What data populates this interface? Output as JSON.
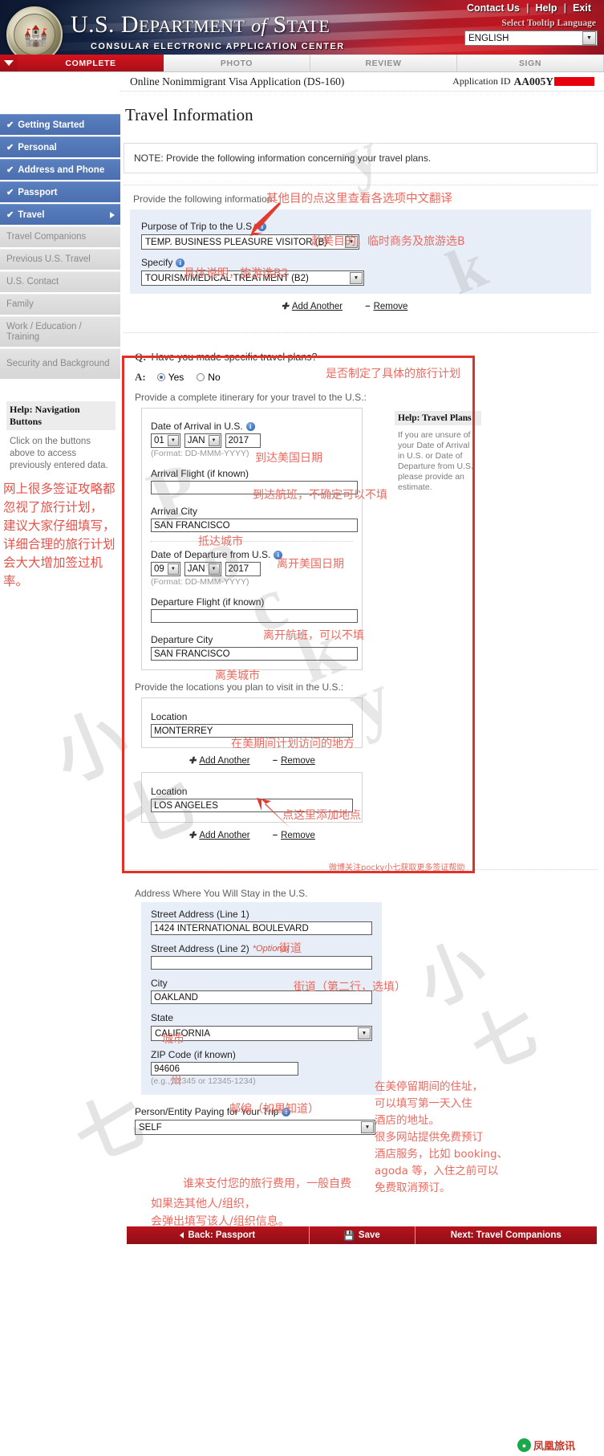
{
  "header": {
    "title_us": "U.S.",
    "title_dept": "D",
    "title_dept_rest": "EPARTMENT",
    "title_of": "of",
    "title_state_s": "S",
    "title_state_rest": "TATE",
    "subtitle": "CONSULAR ELECTRONIC APPLICATION CENTER",
    "links": [
      "Contact Us",
      "Help",
      "Exit"
    ],
    "tooltip_label": "Select Tooltip Language",
    "language_value": "ENGLISH",
    "seal_icon": "eagle-seal-icon"
  },
  "tabs": [
    {
      "label": "COMPLETE",
      "active": true
    },
    {
      "label": "PHOTO",
      "active": false
    },
    {
      "label": "REVIEW",
      "active": false
    },
    {
      "label": "SIGN",
      "active": false
    }
  ],
  "sidebar": {
    "items": [
      {
        "label": "Getting Started",
        "completed": true,
        "expanded": false
      },
      {
        "label": "Personal",
        "completed": true,
        "expanded": false
      },
      {
        "label": "Address and Phone",
        "completed": true,
        "expanded": false
      },
      {
        "label": "Passport",
        "completed": true,
        "expanded": false
      },
      {
        "label": "Travel",
        "completed": true,
        "expanded": true
      }
    ],
    "sub_items": [
      "Travel Companions",
      "Previous U.S. Travel",
      "U.S. Contact",
      "Family",
      "Work / Education / Training",
      "Security and Background"
    ],
    "help": {
      "title": "Help: Navigation Buttons",
      "body": "Click on the buttons above to access previously entered data."
    },
    "annotation_cn": [
      "网上很多签证攻略都",
      "忽视了旅行计划，",
      "建议大家仔细填写，",
      "详细合理的旅行计划",
      "会大大增加签过机率。"
    ]
  },
  "appbar": {
    "app_name": "Online Nonimmigrant Visa Application (DS-160)",
    "app_id_label": "Application ID",
    "app_id_value": "AA005Y"
  },
  "page": {
    "title": "Travel Information",
    "note": "NOTE: Provide the following information concerning your travel plans."
  },
  "purpose_section": {
    "lead": "Provide the following information:",
    "purpose_label": "Purpose of Trip to the U.S.",
    "purpose_value": "TEMP. BUSINESS PLEASURE VISITOR (B)",
    "specify_label": "Specify",
    "specify_value": "TOURISM/MEDICAL TREATMENT (B2)",
    "add_another": "Add Another",
    "remove": "Remove",
    "cn_top": "其他目的点这里查看各选项中文翻译",
    "cn_purpose": "赴美目的，临时商务及旅游选B",
    "cn_specify": "具体说明，旅游选B2"
  },
  "travel_plans": {
    "question_q": "Q:",
    "question": "Have you made specific travel plans?",
    "answer_a": "A:",
    "yes": "Yes",
    "no": "No",
    "selected": "Yes",
    "cn_question": "是否制定了具体的旅行计划",
    "itinerary_lead": "Provide a complete itinerary for your travel to the U.S.:",
    "arrival_date_label": "Date of Arrival in U.S.",
    "arrival_day": "01",
    "arrival_month": "JAN",
    "arrival_year": "2017",
    "date_format": "(Format: DD-MMM-YYYY)",
    "cn_arrival_date": "到达美国日期",
    "arrival_flight_label": "Arrival Flight (if known)",
    "arrival_flight_value": "",
    "cn_arrival_flight": "到达航班，不确定可以不填",
    "arrival_city_label": "Arrival City",
    "arrival_city_value": "SAN FRANCISCO",
    "cn_arrival_city": "抵达城市",
    "departure_date_label": "Date of Departure from U.S.",
    "departure_day": "09",
    "departure_month": "JAN",
    "departure_year": "2017",
    "cn_departure_date": "离开美国日期",
    "departure_flight_label": "Departure Flight (if known)",
    "departure_flight_value": "",
    "cn_departure_flight": "离开航班，可以不填",
    "departure_city_label": "Departure City",
    "departure_city_value": "SAN FRANCISCO",
    "cn_departure_city": "离美城市",
    "locations_lead": "Provide the locations you plan to visit in the U.S.:",
    "cn_locations": "在美期间计划访问的地方",
    "location_label": "Location",
    "location_1": "MONTERREY",
    "location_2": "LOS ANGELES",
    "add_another": "Add Another",
    "remove": "Remove",
    "cn_add_location": "点这里添加地点",
    "cn_watermark_note": "微博关注pocky小七获取更多签证帮助"
  },
  "help_travel_plans": {
    "title": "Help: Travel Plans",
    "body": "If you are unsure of your Date of Arrival in U.S. or Date of Departure from U.S., please provide an estimate."
  },
  "stay_address": {
    "lead": "Address Where You Will Stay in the U.S.",
    "street1_label": "Street Address (Line 1)",
    "street1_value": "1424 INTERNATIONAL BOULEVARD",
    "cn_street1": "街道",
    "street2_label": "Street Address (Line 2)",
    "street2_optional": "*Optional",
    "street2_value": "",
    "cn_street2": "街道（第二行，选填）",
    "city_label": "City",
    "city_value": "OAKLAND",
    "cn_city": "城市",
    "state_label": "State",
    "state_value": "CALIFORNIA",
    "cn_state": "州",
    "zip_label": "ZIP Code (if known)",
    "zip_value": "94606",
    "zip_hint": "(e.g., 12345 or 12345-1234)",
    "cn_zip": "邮编（如果知道）",
    "cn_side_note": [
      "在美停留期间的住址，",
      "可以填写第一天入住",
      "酒店的地址。",
      "很多网站提供免费预订",
      "酒店服务，比如 booking、",
      "agoda 等，入住之前可以",
      "免费取消预订。"
    ]
  },
  "payer": {
    "label": "Person/Entity Paying for Your Trip",
    "value": "SELF",
    "cn_note_1": "谁来支付您的旅行费用，一般自费",
    "cn_note_2": "如果选其他人/组织，",
    "cn_note_3": "会弹出填写该人/组织信息。"
  },
  "footer": {
    "back": "Back: Passport",
    "save": "Save",
    "next": "Next: Travel Companions",
    "save_icon": "floppy-disk-icon",
    "back_icon": "triangle-left-icon"
  },
  "watermarks": {
    "big": "Pocky小七",
    "wechat": "凤凰旅讯"
  },
  "colors": {
    "brand_red": "#b11a22",
    "nav_blue": "#4b6fae",
    "annotation_red": "#ea6a60",
    "panel_blue": "#e8eef8",
    "highlight_box": "#e23127"
  }
}
